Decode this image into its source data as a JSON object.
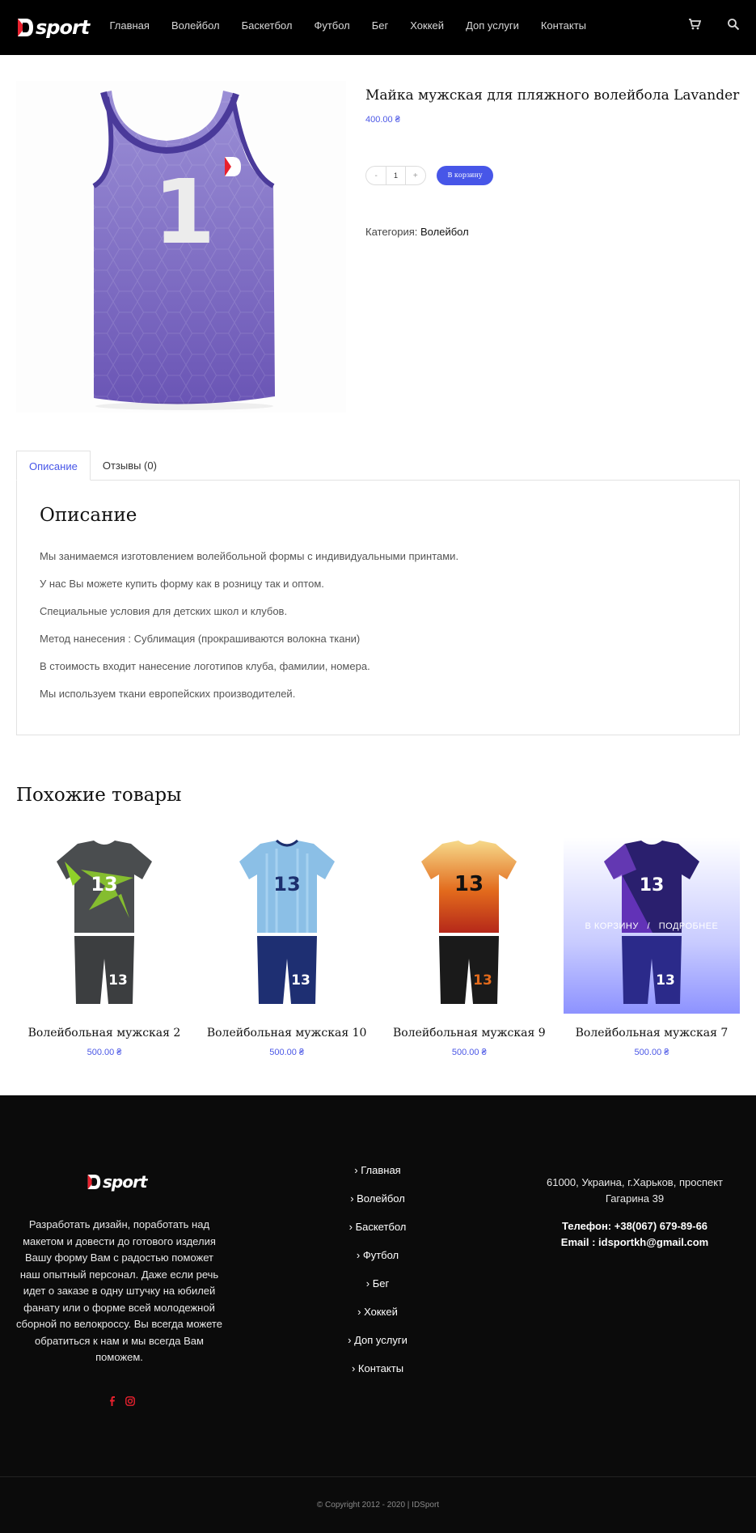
{
  "header": {
    "nav": [
      "Главная",
      "Волейбол",
      "Баскетбол",
      "Футбол",
      "Бег",
      "Хоккей",
      "Доп услуги",
      "Контакты"
    ],
    "icons": [
      "cart-icon",
      "search-icon"
    ]
  },
  "product": {
    "title": "Майка мужская для пляжного волейбола Lavander",
    "price": "400.00 ₴",
    "quantity": "1",
    "qty_minus": "-",
    "qty_plus": "+",
    "add_to_cart": "В корзину",
    "category_label": "Категория:",
    "category_value": "Волейбол",
    "jersey_number": "1"
  },
  "tabs": {
    "description": "Описание",
    "reviews": "Отзывы (0)"
  },
  "description": {
    "title": "Описание",
    "lines": [
      "Мы занимаемся изготовлением волейбольной формы с индивидуальными принтами.",
      "У нас Вы можете купить форму как в розницу так и оптом.",
      "Специальные условия для детских школ и клубов.",
      "Метод нанесения : Сублимация (прокрашиваются волокна ткани)",
      "В стоимость входит нанесение логотипов клуба, фамилии, номера.",
      "Мы используем ткани европейских производителей."
    ]
  },
  "related": {
    "title": "Похожие товары",
    "overlay_cart": "В КОРЗИНУ",
    "overlay_sep": "/",
    "overlay_more": "ПОДРОБНЕЕ",
    "items": [
      {
        "name": "Волейбольная мужская 2",
        "price": "500.00 ₴",
        "number": "13"
      },
      {
        "name": "Волейбольная мужская 10",
        "price": "500.00 ₴",
        "number": "13"
      },
      {
        "name": "Волейбольная мужская 9",
        "price": "500.00 ₴",
        "number": "13"
      },
      {
        "name": "Волейбольная мужская 7",
        "price": "500.00 ₴",
        "number": "13"
      }
    ]
  },
  "footer": {
    "about": "Разработать дизайн, поработать над макетом и довести до готового изделия Вашу форму Вам с радостью поможет наш опытный персонал. Даже если речь идет о заказе в одну штучку на юбилей фанату или о форме всей молодежной сборной по велокроссу. Вы всегда можете обратиться к нам и мы всегда Вам поможем.",
    "menu": [
      "Главная",
      "Волейбол",
      "Баскетбол",
      "Футбол",
      "Бег",
      "Хоккей",
      "Доп услуги",
      "Контакты"
    ],
    "address": "61000, Украина, г.Харьков, проспект Гагарина 39",
    "phone": "Телефон: +38(067) 679-89-66",
    "email": "Email : idsportkh@gmail.com",
    "copyright": "© Copyright 2012 - 2020 | IDSport"
  },
  "brand": {
    "logo_text": "sport",
    "accent": "#4756e8",
    "logo_red": "#e8212e"
  }
}
